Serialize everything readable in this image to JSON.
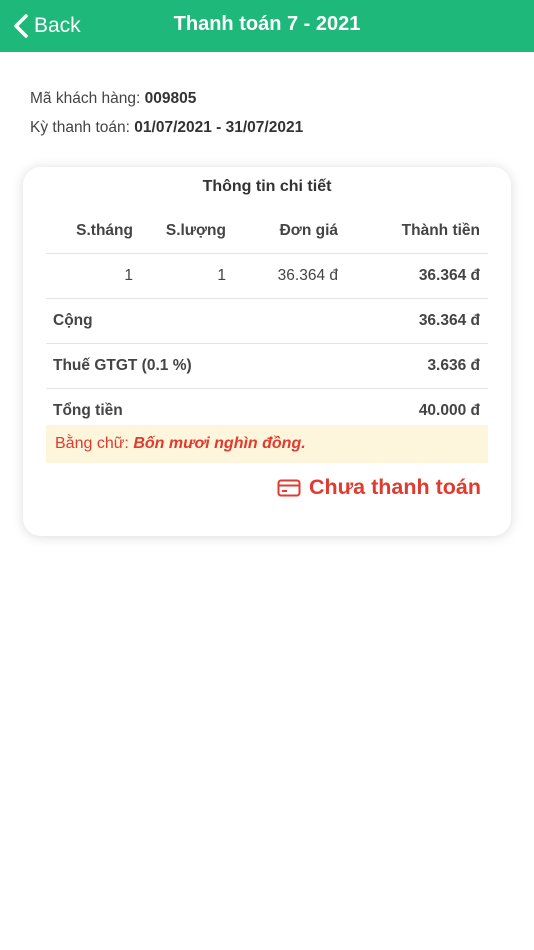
{
  "header": {
    "back_label": "Back",
    "title": "Thanh toán 7 - 2021"
  },
  "info": {
    "customer_label": "Mã khách hàng: ",
    "customer_value": "009805",
    "period_label": "Kỳ thanh toán: ",
    "period_value": "01/07/2021 - 31/07/2021"
  },
  "card": {
    "title": "Thông tin chi tiết",
    "columns": [
      "S.tháng",
      "S.lượng",
      "Đơn giá",
      "Thành tiền"
    ],
    "row": {
      "months": "1",
      "quantity": "1",
      "unit_price": "36.364 đ",
      "amount": "36.364 đ"
    },
    "subtotal_label": "Cộng",
    "subtotal_value": "36.364 đ",
    "tax_label": "Thuế GTGT (0.1 %)",
    "tax_value": "3.636 đ",
    "total_label": "Tổng tiền",
    "total_value": "40.000 đ",
    "words_label": "Bằng chữ: ",
    "words_value": "Bốn mươi nghìn đồng.",
    "status": "Chưa thanh toán"
  },
  "colors": {
    "header": "#1eb87a",
    "alert": "#e13a2e",
    "words_bg": "#fdf5dc"
  },
  "icons": {
    "back": "chevron-left-icon",
    "status": "credit-card-icon"
  }
}
